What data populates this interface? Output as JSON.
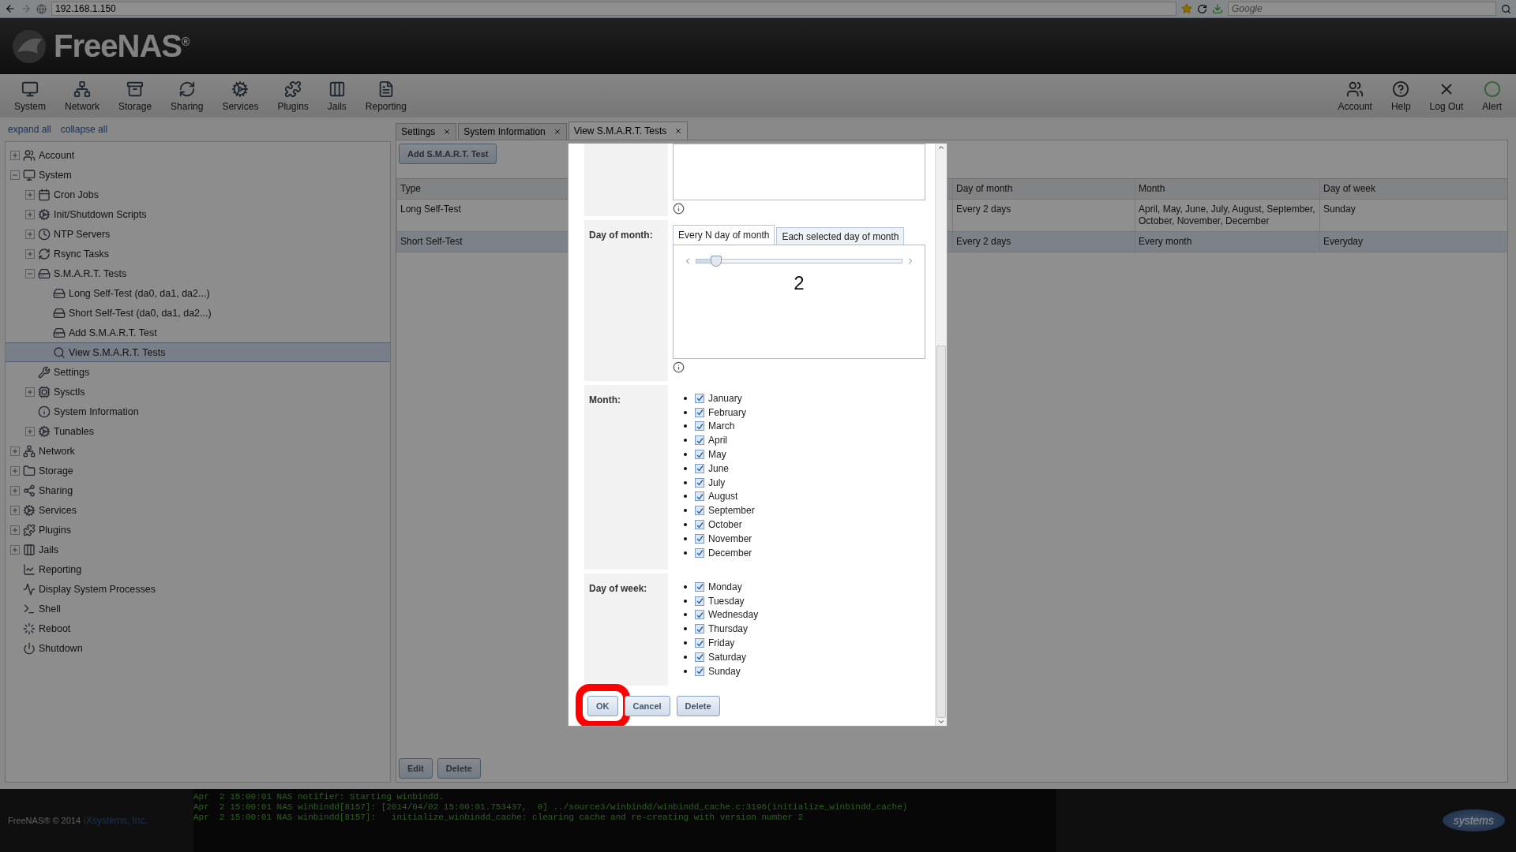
{
  "browser": {
    "url": "192.168.1.150",
    "search_placeholder": "Google"
  },
  "header": {
    "logo": "FreeNAS$^{®}$"
  },
  "toolbar": {
    "left": [
      "System",
      "Network",
      "Storage",
      "Sharing",
      "Services",
      "Plugins",
      "Jails",
      "Reporting"
    ],
    "right": [
      "Account",
      "Help",
      "Log Out",
      "Alert"
    ]
  },
  "sidebar": {
    "links": [
      "expand all",
      "collapse all"
    ],
    "tree": [
      {
        "label": "Account",
        "expanded": false,
        "selected": false
      },
      {
        "label": "System",
        "expanded": true,
        "selected": false,
        "children": [
          {
            "label": "Cron Jobs",
            "expanded": false,
            "selected": false
          },
          {
            "label": "Init/Shutdown Scripts",
            "expanded": false,
            "selected": false
          },
          {
            "label": "NTP Servers",
            "expanded": false,
            "selected": false
          },
          {
            "label": "Rsync Tasks",
            "expanded": false,
            "selected": false
          },
          {
            "label": "S.M.A.R.T. Tests",
            "expanded": true,
            "selected": false,
            "children": [
              {
                "label": "Long Self-Test (da0, da1, da2...)",
                "selected": false
              },
              {
                "label": "Short Self-Test (da0, da1, da2...)",
                "selected": false
              },
              {
                "label": "Add S.M.A.R.T. Test",
                "selected": false
              },
              {
                "label": "View S.M.A.R.T. Tests",
                "selected": true
              }
            ]
          },
          {
            "label": "Settings",
            "selected": false
          },
          {
            "label": "Sysctls",
            "expanded": false,
            "selected": false
          },
          {
            "label": "System Information",
            "selected": false
          },
          {
            "label": "Tunables",
            "expanded": false,
            "selected": false
          }
        ]
      },
      {
        "label": "Network",
        "expanded": false,
        "selected": false
      },
      {
        "label": "Storage",
        "expanded": false,
        "selected": false
      },
      {
        "label": "Sharing",
        "expanded": false,
        "selected": false
      },
      {
        "label": "Services",
        "expanded": false,
        "selected": false
      },
      {
        "label": "Plugins",
        "expanded": false,
        "selected": false
      },
      {
        "label": "Jails",
        "expanded": false,
        "selected": false
      },
      {
        "label": "Reporting",
        "selected": false
      },
      {
        "label": "Display System Processes",
        "selected": false
      },
      {
        "label": "Shell",
        "selected": false
      },
      {
        "label": "Reboot",
        "selected": false
      },
      {
        "label": "Shutdown",
        "selected": false
      }
    ]
  },
  "tabs": [
    {
      "label": "Settings",
      "selected": false
    },
    {
      "label": "System Information",
      "selected": false
    },
    {
      "label": "View S.M.A.R.T. Tests",
      "selected": true
    }
  ],
  "content": {
    "add_button": "Add S.M.A.R.T. Test",
    "table": {
      "columns": [
        "Type",
        "Day of month",
        "Month",
        "Day of week"
      ],
      "rows": [
        {
          "cells": [
            "Long Self-Test",
            "Every 2 days",
            "April, May, June, July, August, September, October, November, December",
            "Sunday"
          ],
          "selected": false
        },
        {
          "cells": [
            "Short Self-Test",
            "Every 2 days",
            "Every month",
            "Everyday"
          ],
          "selected": true
        }
      ]
    },
    "buttons": [
      "Edit",
      "Delete"
    ]
  },
  "dialog": {
    "day_of_month": {
      "label": "Day of month:",
      "tabs": [
        {
          "label": "Every N day of month",
          "selected": true
        },
        {
          "label": "Each selected day of month",
          "selected": false
        }
      ],
      "level": 0.1,
      "value": "2"
    },
    "month": {
      "label": "Month:",
      "options": [
        {
          "label": "January",
          "checked": true
        },
        {
          "label": "February",
          "checked": true
        },
        {
          "label": "March",
          "checked": true
        },
        {
          "label": "April",
          "checked": true
        },
        {
          "label": "May",
          "checked": true
        },
        {
          "label": "June",
          "checked": true
        },
        {
          "label": "July",
          "checked": true
        },
        {
          "label": "August",
          "checked": true
        },
        {
          "label": "September",
          "checked": true
        },
        {
          "label": "October",
          "checked": true
        },
        {
          "label": "November",
          "checked": true
        },
        {
          "label": "December",
          "checked": true
        }
      ]
    },
    "day_of_week": {
      "label": "Day of week:",
      "options": [
        {
          "label": "Monday",
          "checked": true
        },
        {
          "label": "Tuesday",
          "checked": true
        },
        {
          "label": "Wednesday",
          "checked": true
        },
        {
          "label": "Thursday",
          "checked": true
        },
        {
          "label": "Friday",
          "checked": true
        },
        {
          "label": "Saturday",
          "checked": true
        },
        {
          "label": "Sunday",
          "checked": true
        }
      ]
    },
    "buttons": [
      {
        "label": "OK",
        "highlighted": true
      },
      {
        "label": "Cancel",
        "highlighted": false
      },
      {
        "label": "Delete",
        "highlighted": false
      }
    ]
  },
  "footer": {
    "copyright": "FreeNAS® © 2014",
    "company_link": "iXsystems, Inc.",
    "log": [
      "Apr  2 15:00:01 NAS notifier: Starting winbindd.",
      "Apr  2 15:00:01 NAS winbindd[8157]: [2014/04/02 15:00:01.753437,  0] ../source3/winbindd/winbindd_cache.c:3196(initialize_winbindd_cache)",
      "Apr  2 15:00:01 NAS winbindd[8157]:   initialize_winbindd_cache: clearing cache and re-creating with version number 2"
    ],
    "logo": "systems"
  }
}
